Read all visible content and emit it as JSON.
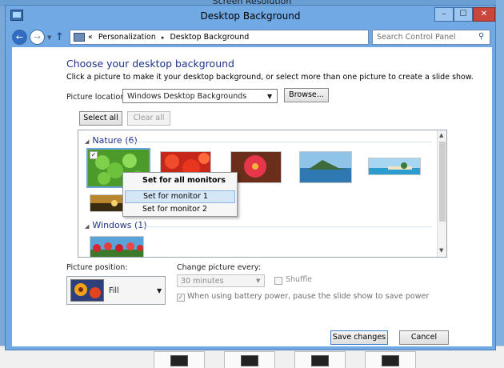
{
  "background_window": {
    "title": "Screen Resolution"
  },
  "window": {
    "title": "Desktop Background",
    "controls": {
      "minimize": "–",
      "maximize": "☐",
      "close": "✕"
    }
  },
  "address_bar": {
    "prefix": "«",
    "crumbs": [
      "Personalization",
      "Desktop Background"
    ],
    "separator": "▸",
    "search_placeholder": "Search Control Panel"
  },
  "main": {
    "heading": "Choose your desktop background",
    "subtitle": "Click a picture to make it your desktop background, or select more than one picture to create a slide show.",
    "picture_location_label": "Picture location:",
    "picture_location_value": "Windows Desktop Backgrounds",
    "browse_label": "Browse...",
    "select_all_label": "Select all",
    "clear_all_label": "Clear all"
  },
  "groups": [
    {
      "label": "Nature (6)"
    },
    {
      "label": "Windows (1)"
    }
  ],
  "context_menu": {
    "items": [
      "Set for all monitors",
      "Set for monitor 1",
      "Set for monitor 2"
    ]
  },
  "settings": {
    "position_label": "Picture position:",
    "position_value": "Fill",
    "change_label": "Change picture every:",
    "change_value": "30 minutes",
    "shuffle_label": "Shuffle",
    "battery_label": "When using battery power, pause the slide show to save power",
    "battery_checked": true
  },
  "footer": {
    "save_label": "Save changes",
    "cancel_label": "Cancel"
  },
  "colors": {
    "heading": "#1e3287",
    "titlebar": "#70a9e4",
    "selection": "#6aa3da"
  }
}
